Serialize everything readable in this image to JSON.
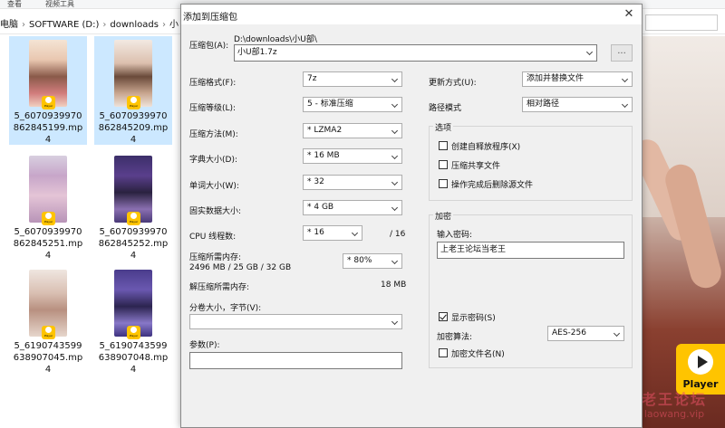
{
  "explorer": {
    "ribbon": {
      "tab_view": "查看",
      "tab_video": "视频工具"
    },
    "breadcrumb": [
      "电脑",
      "SOFTWARE (D:)",
      "downloads",
      "小"
    ],
    "files": [
      {
        "name": "5_6070939970862845199.mp4",
        "lines": [
          "5_6070939970",
          "862845199.mp",
          "4"
        ]
      },
      {
        "name": "5_6070939970862845209.mp4",
        "lines": [
          "5_6070939970",
          "862845209.mp",
          "4"
        ]
      },
      {
        "name": "5_6070939970862845251.mp4",
        "lines": [
          "5_6070939970",
          "862845251.mp",
          "4"
        ]
      },
      {
        "name": "5_6070939970862845252.mp4",
        "lines": [
          "5_6070939970",
          "862845252.mp",
          "4"
        ]
      },
      {
        "name": "5_6190743599638907045.mp4",
        "lines": [
          "5_6190743599",
          "638907045.mp",
          "4"
        ]
      },
      {
        "name": "5_6190743599638907048.mp4",
        "lines": [
          "5_6190743599",
          "638907048.mp",
          "4"
        ]
      }
    ],
    "badge_label": "Player",
    "preview_logo": "Player",
    "watermark": {
      "line1": "老王论坛",
      "line2": "laowang.vip"
    }
  },
  "dialog": {
    "title": "添加到压缩包",
    "close_glyph": "✕",
    "archive": {
      "label": "压缩包(A):",
      "path": "D:\\downloads\\小U部\\",
      "filename": "小U部1.7z",
      "browse": "..."
    },
    "format": {
      "label": "压缩格式(F):",
      "value": "7z"
    },
    "level": {
      "label": "压缩等级(L):",
      "value": "5 - 标准压缩"
    },
    "method": {
      "label": "压缩方法(M):",
      "value": "* LZMA2"
    },
    "dict": {
      "label": "字典大小(D):",
      "value": "* 16 MB"
    },
    "word": {
      "label": "单词大小(W):",
      "value": "* 32"
    },
    "solid": {
      "label": "固实数据大小:",
      "value": "* 4 GB"
    },
    "threads": {
      "label": "CPU 线程数:",
      "value": "* 16",
      "max": "/ 16"
    },
    "mem_compress": {
      "label": "压缩所需内存:",
      "detail": "2496 MB / 25 GB / 32 GB",
      "value": "* 80%"
    },
    "mem_decompress": {
      "label": "解压缩所需内存:",
      "value": "18 MB"
    },
    "split": {
      "label": "分卷大小，字节(V):",
      "value": ""
    },
    "params": {
      "label": "参数(P):",
      "value": ""
    },
    "update": {
      "label": "更新方式(U):",
      "value": "添加并替换文件"
    },
    "path_mode": {
      "label": "路径模式",
      "value": "相对路径"
    },
    "options": {
      "title": "选项",
      "sfx": {
        "label": "创建自释放程序(X)",
        "checked": false
      },
      "shared": {
        "label": "压缩共享文件",
        "checked": false
      },
      "delete": {
        "label": "操作完成后删除源文件",
        "checked": false
      }
    },
    "encryption": {
      "title": "加密",
      "password_label": "输入密码:",
      "password": "上老王论坛当老王",
      "show_password": {
        "label": "显示密码(S)",
        "checked": true
      },
      "method_label": "加密算法:",
      "method": "AES-256",
      "encrypt_names": {
        "label": "加密文件名(N)",
        "checked": false
      }
    }
  }
}
